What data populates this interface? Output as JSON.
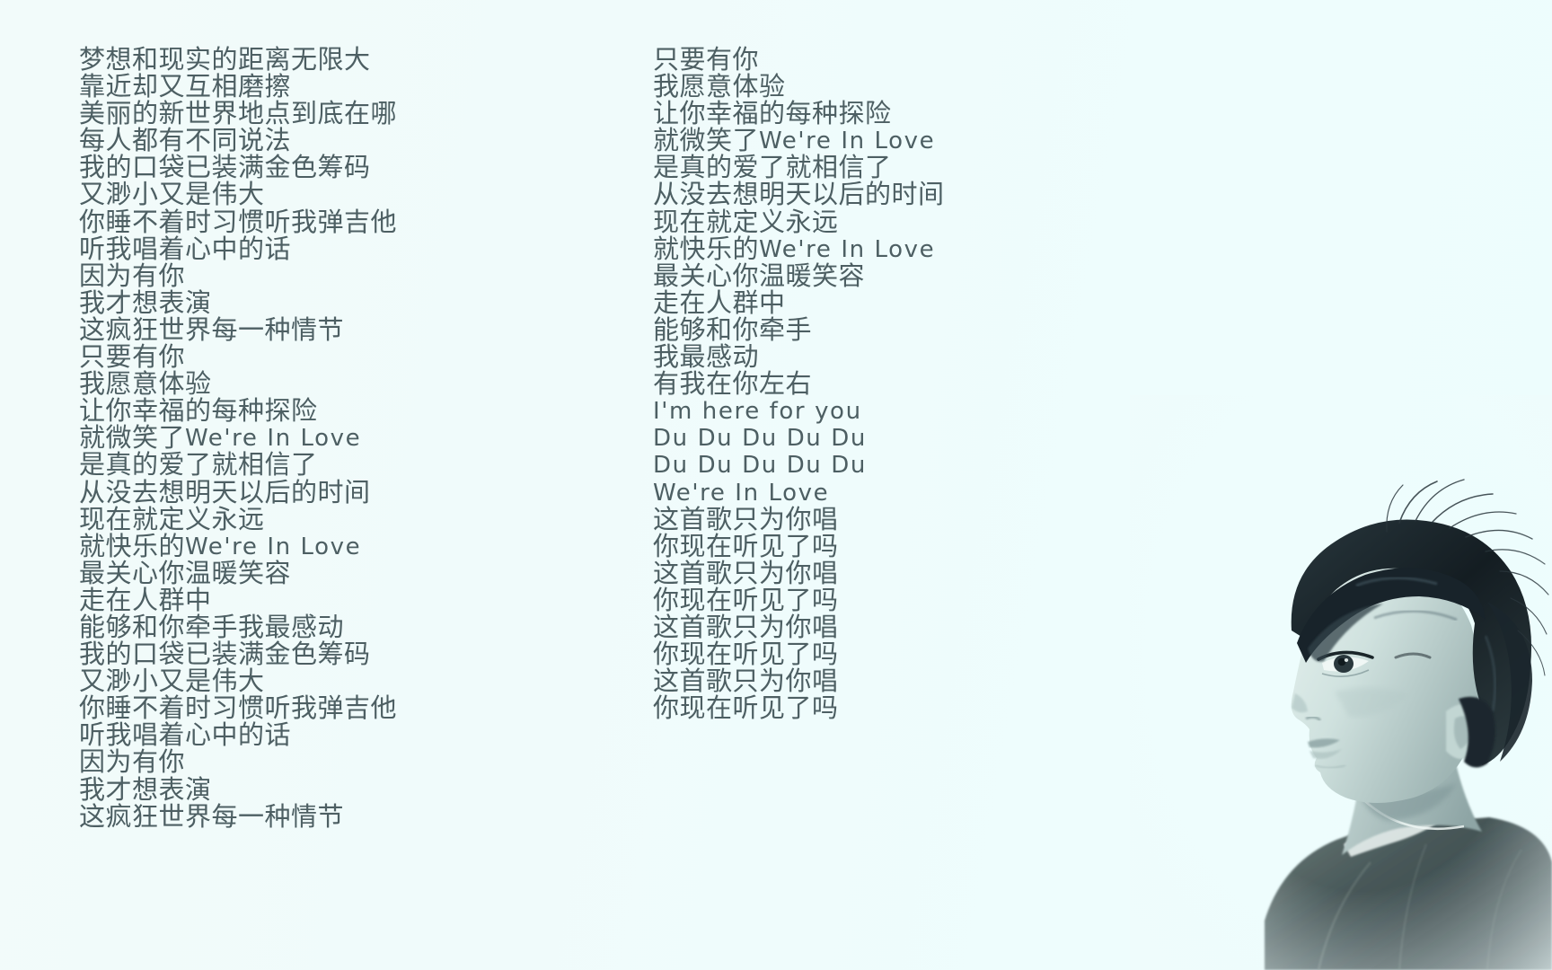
{
  "page": {
    "title": "We're In Love lyrics card",
    "background_color": "#effcfc",
    "text_color": "#4d5f63"
  },
  "lyrics": {
    "left_column": [
      {
        "text": "梦想和现实的距离无限大",
        "script": "cjk"
      },
      {
        "text": "靠近却又互相磨擦",
        "script": "cjk"
      },
      {
        "text": "美丽的新世界地点到底在哪",
        "script": "cjk"
      },
      {
        "text": "每人都有不同说法",
        "script": "cjk"
      },
      {
        "text": "我的口袋已装满金色筹码",
        "script": "cjk"
      },
      {
        "text": "又渺小又是伟大",
        "script": "cjk"
      },
      {
        "text": "你睡不着时习惯听我弹吉他",
        "script": "cjk"
      },
      {
        "text": "听我唱着心中的话",
        "script": "cjk"
      },
      {
        "text": "因为有你",
        "script": "cjk"
      },
      {
        "text": "我才想表演",
        "script": "cjk"
      },
      {
        "text": "这疯狂世界每一种情节",
        "script": "cjk"
      },
      {
        "text": "只要有你",
        "script": "cjk"
      },
      {
        "text": "我愿意体验",
        "script": "cjk"
      },
      {
        "text": "让你幸福的每种探险",
        "script": "cjk"
      },
      {
        "text": "就微笑了",
        "latin": "We're In Love",
        "script": "mixed"
      },
      {
        "text": "是真的爱了就相信了",
        "script": "cjk"
      },
      {
        "text": "从没去想明天以后的时间",
        "script": "cjk"
      },
      {
        "text": "现在就定义永远",
        "script": "cjk"
      },
      {
        "text": "就快乐的",
        "latin": "We're In Love",
        "script": "mixed"
      },
      {
        "text": "最关心你温暖笑容",
        "script": "cjk"
      },
      {
        "text": "走在人群中",
        "script": "cjk"
      },
      {
        "text": "能够和你牵手我最感动",
        "script": "cjk"
      },
      {
        "text": "我的口袋已装满金色筹码",
        "script": "cjk"
      },
      {
        "text": "又渺小又是伟大",
        "script": "cjk"
      },
      {
        "text": "你睡不着时习惯听我弹吉他",
        "script": "cjk"
      },
      {
        "text": "听我唱着心中的话",
        "script": "cjk"
      },
      {
        "text": "因为有你",
        "script": "cjk"
      },
      {
        "text": "我才想表演",
        "script": "cjk"
      },
      {
        "text": "这疯狂世界每一种情节",
        "script": "cjk"
      }
    ],
    "right_column": [
      {
        "text": "只要有你",
        "script": "cjk"
      },
      {
        "text": "我愿意体验",
        "script": "cjk"
      },
      {
        "text": "让你幸福的每种探险",
        "script": "cjk"
      },
      {
        "text": "就微笑了",
        "latin": "We're In Love",
        "script": "mixed"
      },
      {
        "text": "是真的爱了就相信了",
        "script": "cjk"
      },
      {
        "text": "从没去想明天以后的时间",
        "script": "cjk"
      },
      {
        "text": "现在就定义永远",
        "script": "cjk"
      },
      {
        "text": "就快乐的",
        "latin": "We're In Love",
        "script": "mixed"
      },
      {
        "text": "最关心你温暖笑容",
        "script": "cjk"
      },
      {
        "text": "走在人群中",
        "script": "cjk"
      },
      {
        "text": "能够和你牵手",
        "script": "cjk"
      },
      {
        "text": "我最感动",
        "script": "cjk"
      },
      {
        "text": "有我在你左右",
        "script": "cjk"
      },
      {
        "text": "I'm here for you",
        "script": "latin"
      },
      {
        "text": "Du Du Du Du Du",
        "script": "latin"
      },
      {
        "text": "Du Du Du Du Du",
        "script": "latin"
      },
      {
        "text": "We're In Love",
        "script": "latin"
      },
      {
        "text": "这首歌只为你唱",
        "script": "cjk"
      },
      {
        "text": "你现在听见了吗",
        "script": "cjk"
      },
      {
        "text": "这首歌只为你唱",
        "script": "cjk"
      },
      {
        "text": "你现在听见了吗",
        "script": "cjk"
      },
      {
        "text": "这首歌只为你唱",
        "script": "cjk"
      },
      {
        "text": "你现在听见了吗",
        "script": "cjk"
      },
      {
        "text": "这首歌只为你唱",
        "script": "cjk"
      },
      {
        "text": "你现在听见了吗",
        "script": "cjk"
      }
    ]
  },
  "portrait": {
    "description": "monochrome cyan-tinted profile photograph of a young man looking upward to the left",
    "hair_color": "#1d282c",
    "skin_color": "#cfe0dd",
    "shirt_color": "#4d5c59"
  }
}
